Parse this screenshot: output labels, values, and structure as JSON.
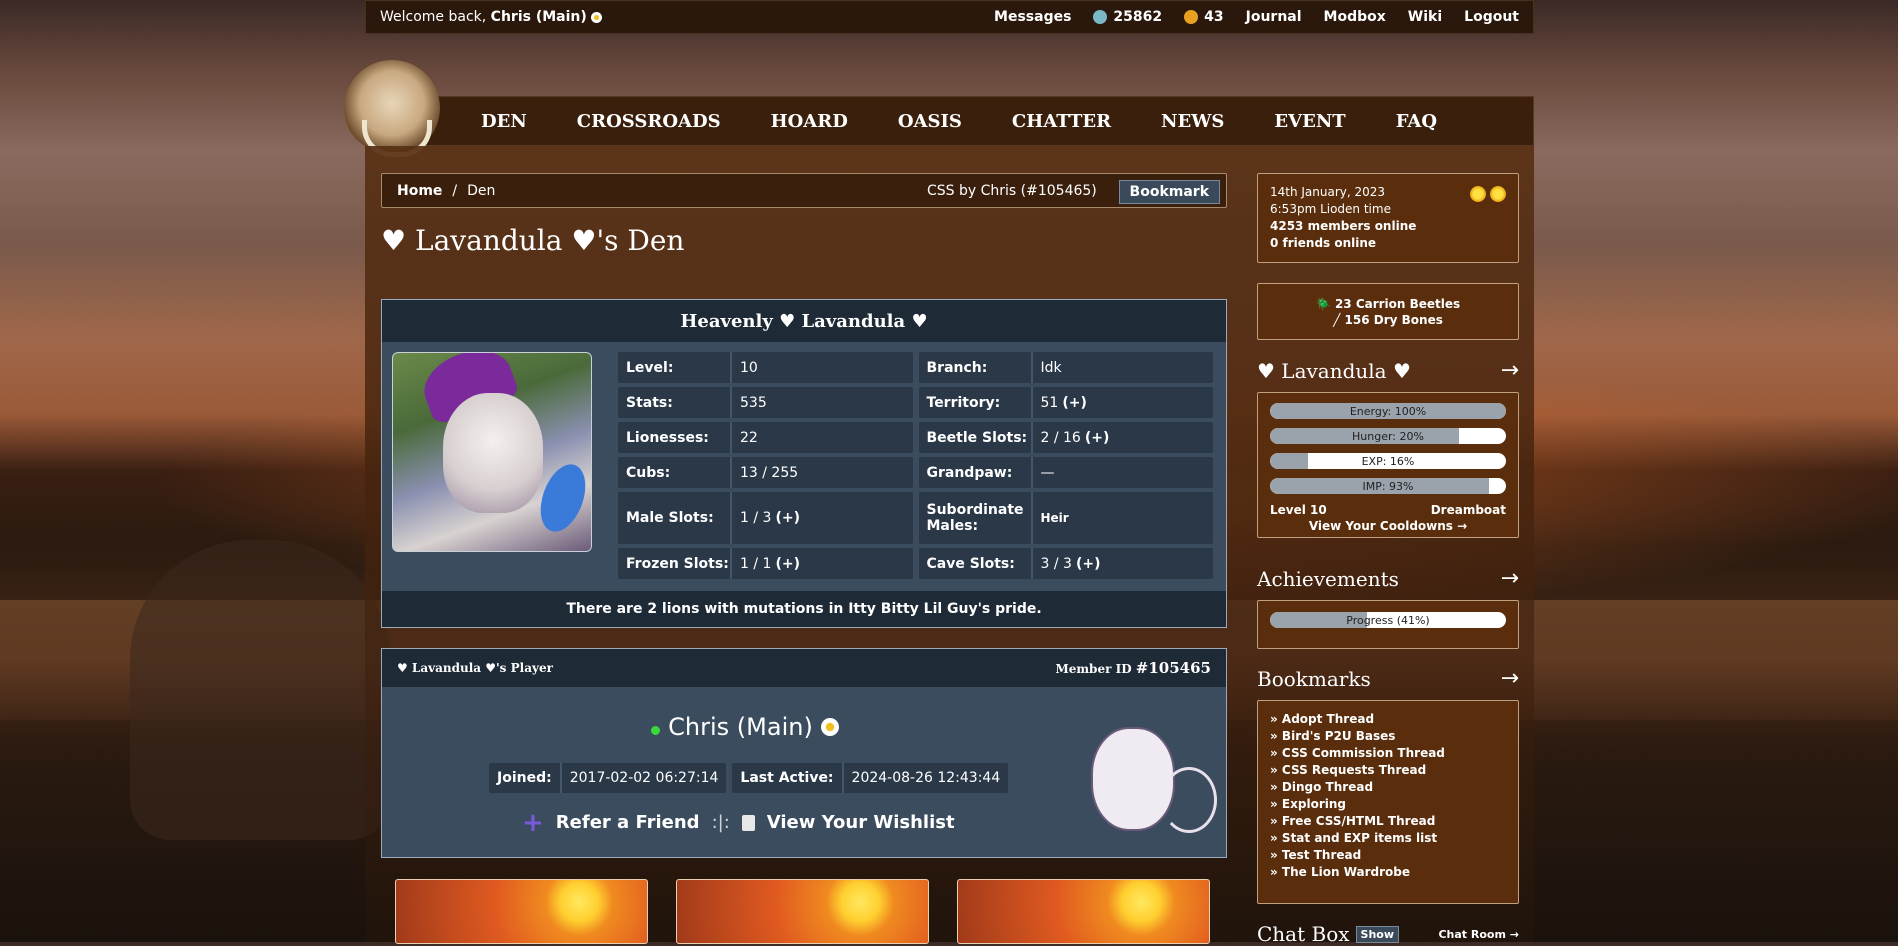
{
  "topbar": {
    "welcome_prefix": "Welcome back,",
    "user": "Chris (Main)",
    "messages": "Messages",
    "currency1": "25862",
    "currency2": "43",
    "journal": "Journal",
    "modbox": "Modbox",
    "wiki": "Wiki",
    "logout": "Logout"
  },
  "nav": [
    "DEN",
    "CROSSROADS",
    "HOARD",
    "OASIS",
    "CHATTER",
    "NEWS",
    "EVENT",
    "FAQ"
  ],
  "breadcrumb": {
    "home": "Home",
    "sep": "/",
    "current": "Den",
    "css_credit": "CSS by Chris (#105465)",
    "bookmark": "Bookmark"
  },
  "den_title": "♥ Lavandula ♥'s Den",
  "lion": {
    "name": "Heavenly ♥ Lavandula ♥",
    "stats": {
      "level_k": "Level:",
      "level_v": "10",
      "branch_k": "Branch:",
      "branch_v": "Idk",
      "stats_k": "Stats:",
      "stats_v": "535",
      "territory_k": "Territory:",
      "territory_v": "51",
      "lionesses_k": "Lionesses:",
      "lionesses_v": "22",
      "beetle_k": "Beetle Slots:",
      "beetle_v": "2 / 16",
      "cubs_k": "Cubs:",
      "cubs_v": "13 / 255",
      "grandpaw_k": "Grandpaw:",
      "grandpaw_v": "—",
      "male_k": "Male Slots:",
      "male_v": "1 / 3",
      "sub_k": "Subordinate Males:",
      "sub_v": "Heir",
      "frozen_k": "Frozen Slots:",
      "frozen_v": "1 / 1",
      "cave_k": "Cave Slots:",
      "cave_v": "3 / 3"
    },
    "plus": "(+)",
    "mutation_note": "There are 2 lions with mutations in Itty Bitty Lil Guy's pride."
  },
  "player": {
    "title": "♥ Lavandula ♥'s Player",
    "member_label": "Member ID",
    "member_id": "#105465",
    "name": "Chris (Main)",
    "joined_k": "Joined:",
    "joined_v": "2017-02-02 06:27:14",
    "active_k": "Last Active:",
    "active_v": "2024-08-26 12:43:44",
    "refer": "Refer a Friend",
    "sep": ":|:",
    "wishlist": "View Your Wishlist"
  },
  "sidebar": {
    "date": "14th January, 2023",
    "time": "6:53pm Lioden time",
    "members_online": "4253 members online",
    "friends_online": "0 friends online",
    "beetles": "23 Carrion Beetles",
    "bones": "156 Dry Bones",
    "lion_title": "♥ Lavandula ♥",
    "arrow": "→",
    "bars": [
      {
        "label": "Energy: 100%",
        "pct": 100
      },
      {
        "label": "Hunger: 20%",
        "pct": 80
      },
      {
        "label": "EXP: 16%",
        "pct": 16
      },
      {
        "label": "IMP: 93%",
        "pct": 93
      }
    ],
    "level": "Level 10",
    "title_rank": "Dreamboat",
    "cooldowns": "View Your Cooldowns →",
    "achievements": "Achievements",
    "progress": "Progress (41%)",
    "progress_pct": 41,
    "bookmarks_title": "Bookmarks",
    "bookmarks": [
      "» Adopt Thread",
      "» Bird's P2U Bases",
      "» CSS Commission Thread",
      "» CSS Requests Thread",
      "» Dingo Thread",
      "» Exploring",
      "» Free CSS/HTML Thread",
      "» Stat and EXP items list",
      "» Test Thread",
      "» The Lion Wardrobe"
    ],
    "chat_box": "Chat Box",
    "show": "Show",
    "chat_room": "Chat Room →"
  },
  "colors": {
    "accent_brown": "#5a2e0c",
    "panel_blue": "#3a4c5e",
    "online_green": "#3ad83a"
  }
}
